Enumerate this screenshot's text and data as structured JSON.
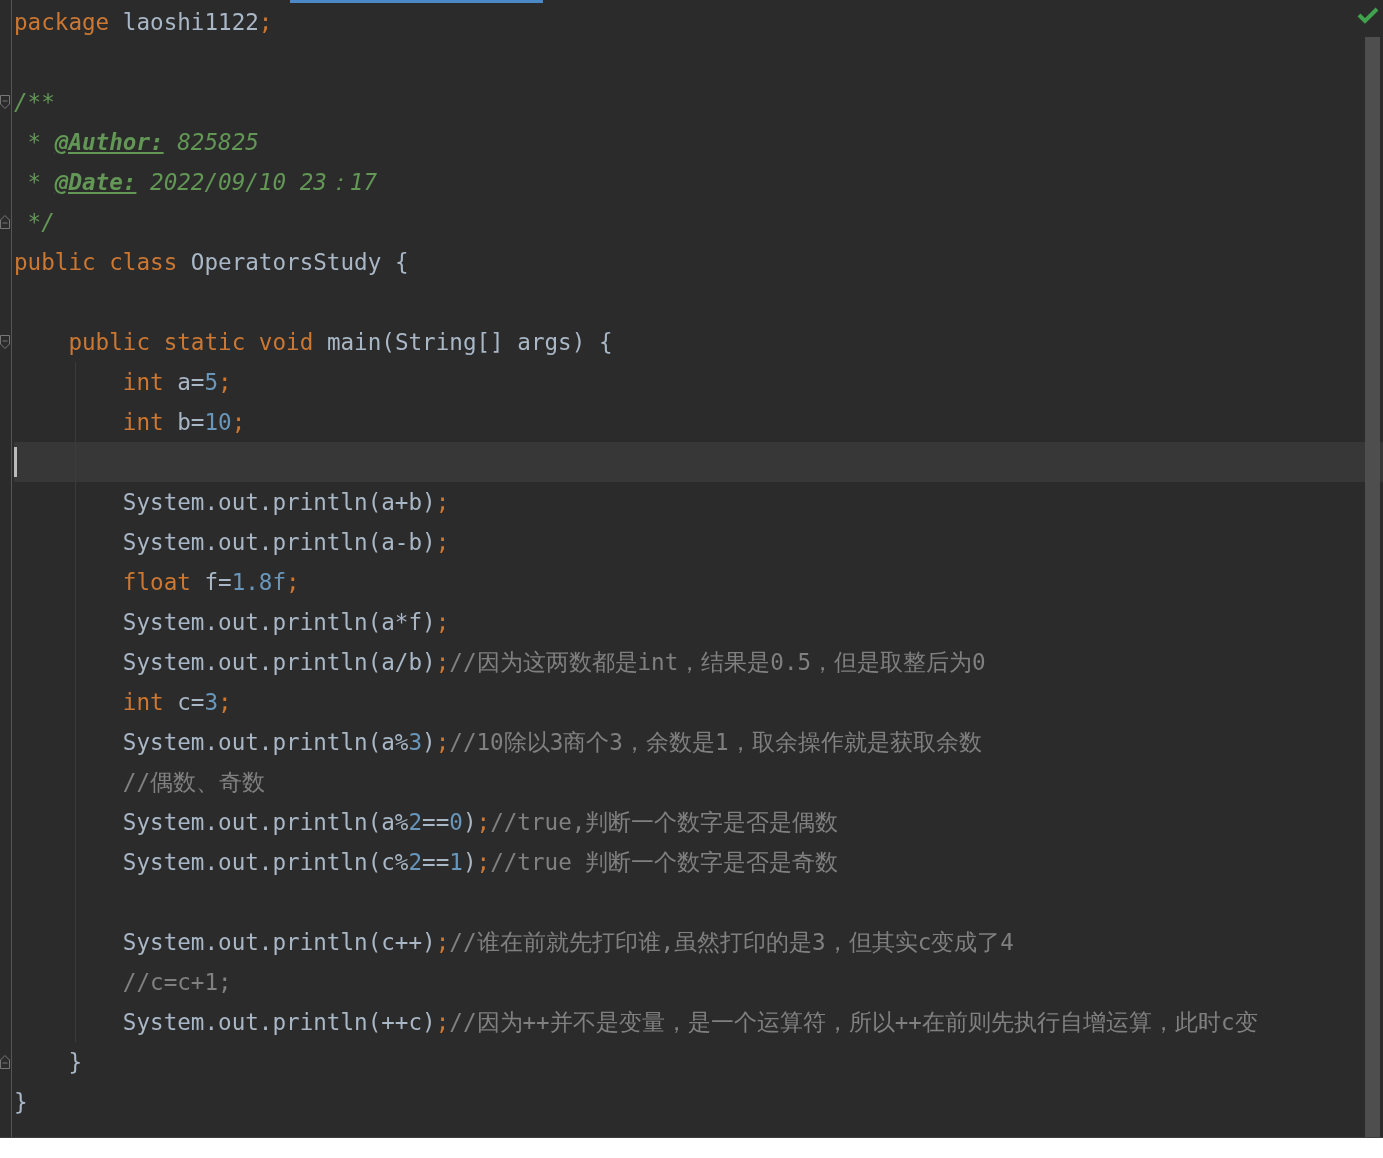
{
  "editor": {
    "lines": [
      {
        "kind": "line",
        "tokens": [
          {
            "kind": "keyword",
            "text": "package "
          },
          {
            "kind": "plain",
            "text": "laoshi1122"
          },
          {
            "kind": "punct",
            "text": ";"
          }
        ]
      },
      {
        "kind": "line"
      },
      {
        "kind": "opener",
        "tokens": [
          {
            "kind": "doc",
            "text": "/**"
          }
        ]
      },
      {
        "kind": "line",
        "tokens": [
          {
            "kind": "doc",
            "text": " * "
          },
          {
            "kind": "tag",
            "text": "@Author:"
          },
          {
            "kind": "doc",
            "text": " 825825"
          }
        ]
      },
      {
        "kind": "line",
        "tokens": [
          {
            "kind": "doc",
            "text": " * "
          },
          {
            "kind": "tag",
            "text": "@Date:"
          },
          {
            "kind": "doc",
            "text": " 2022/09/10 23：17"
          }
        ]
      },
      {
        "kind": "closer",
        "tokens": [
          {
            "kind": "doc",
            "text": " */"
          }
        ]
      },
      {
        "kind": "line",
        "tokens": [
          {
            "kind": "keyword",
            "text": "public class "
          },
          {
            "kind": "plain",
            "text": "OperatorsStudy {"
          }
        ]
      },
      {
        "kind": "line"
      },
      {
        "kind": "opener",
        "tokens": [
          {
            "kind": "keyword",
            "text": "    public static void "
          },
          {
            "kind": "plain",
            "text": "main(String[] args) {"
          }
        ]
      },
      {
        "kind": "line",
        "tokens": [
          {
            "kind": "keyword",
            "text": "        int "
          },
          {
            "kind": "plain",
            "text": "a="
          },
          {
            "kind": "number",
            "text": "5"
          },
          {
            "kind": "punct",
            "text": ";"
          }
        ]
      },
      {
        "kind": "line",
        "tokens": [
          {
            "kind": "keyword",
            "text": "        int "
          },
          {
            "kind": "plain",
            "text": "b="
          },
          {
            "kind": "number",
            "text": "10"
          },
          {
            "kind": "punct",
            "text": ";"
          }
        ]
      },
      {
        "kind": "caret"
      },
      {
        "kind": "line",
        "tokens": [
          {
            "kind": "plain",
            "text": "        System.out.println(a+b)"
          },
          {
            "kind": "punct",
            "text": ";"
          }
        ]
      },
      {
        "kind": "line",
        "tokens": [
          {
            "kind": "plain",
            "text": "        System.out.println(a-b)"
          },
          {
            "kind": "punct",
            "text": ";"
          }
        ]
      },
      {
        "kind": "line",
        "tokens": [
          {
            "kind": "keyword",
            "text": "        float "
          },
          {
            "kind": "plain",
            "text": "f="
          },
          {
            "kind": "number",
            "text": "1.8f"
          },
          {
            "kind": "punct",
            "text": ";"
          }
        ]
      },
      {
        "kind": "line",
        "tokens": [
          {
            "kind": "plain",
            "text": "        System.out.println(a*f)"
          },
          {
            "kind": "punct",
            "text": ";"
          }
        ]
      },
      {
        "kind": "line",
        "tokens": [
          {
            "kind": "plain",
            "text": "        System.out.println(a/b)"
          },
          {
            "kind": "punct",
            "text": ";"
          },
          {
            "kind": "comment",
            "text": "//因为这两数都是int，结果是0.5，但是取整后为0"
          }
        ]
      },
      {
        "kind": "line",
        "tokens": [
          {
            "kind": "keyword",
            "text": "        int "
          },
          {
            "kind": "plain",
            "text": "c="
          },
          {
            "kind": "number",
            "text": "3"
          },
          {
            "kind": "punct",
            "text": ";"
          }
        ]
      },
      {
        "kind": "line",
        "tokens": [
          {
            "kind": "plain",
            "text": "        System.out.println(a%"
          },
          {
            "kind": "number",
            "text": "3"
          },
          {
            "kind": "plain",
            "text": ")"
          },
          {
            "kind": "punct",
            "text": ";"
          },
          {
            "kind": "comment",
            "text": "//10除以3商个3，余数是1，取余操作就是获取余数"
          }
        ]
      },
      {
        "kind": "line",
        "tokens": [
          {
            "kind": "comment",
            "text": "        //偶数、奇数"
          }
        ]
      },
      {
        "kind": "line",
        "tokens": [
          {
            "kind": "plain",
            "text": "        System.out.println(a%"
          },
          {
            "kind": "number",
            "text": "2"
          },
          {
            "kind": "plain",
            "text": "=="
          },
          {
            "kind": "number",
            "text": "0"
          },
          {
            "kind": "plain",
            "text": ")"
          },
          {
            "kind": "punct",
            "text": ";"
          },
          {
            "kind": "comment",
            "text": "//true,判断一个数字是否是偶数"
          }
        ]
      },
      {
        "kind": "line",
        "tokens": [
          {
            "kind": "plain",
            "text": "        System.out.println(c%"
          },
          {
            "kind": "number",
            "text": "2"
          },
          {
            "kind": "plain",
            "text": "=="
          },
          {
            "kind": "number",
            "text": "1"
          },
          {
            "kind": "plain",
            "text": ")"
          },
          {
            "kind": "punct",
            "text": ";"
          },
          {
            "kind": "comment",
            "text": "//true 判断一个数字是否是奇数"
          }
        ]
      },
      {
        "kind": "line"
      },
      {
        "kind": "line",
        "tokens": [
          {
            "kind": "plain",
            "text": "        System.out.println(c++)"
          },
          {
            "kind": "punct",
            "text": ";"
          },
          {
            "kind": "comment",
            "text": "//谁在前就先打印谁,虽然打印的是3，但其实c变成了4"
          }
        ]
      },
      {
        "kind": "line",
        "tokens": [
          {
            "kind": "comment",
            "text": "        //c=c+1;"
          }
        ]
      },
      {
        "kind": "line",
        "tokens": [
          {
            "kind": "plain",
            "text": "        System.out.println(++c)"
          },
          {
            "kind": "punct",
            "text": ";"
          },
          {
            "kind": "comment",
            "text": "//因为++并不是变量，是一个运算符，所以++在前则先执行自增运算，此时c变"
          }
        ]
      },
      {
        "kind": "closer",
        "tokens": [
          {
            "kind": "plain",
            "text": "    }"
          }
        ]
      },
      {
        "kind": "line",
        "tokens": [
          {
            "kind": "plain",
            "text": "}"
          }
        ]
      }
    ]
  }
}
